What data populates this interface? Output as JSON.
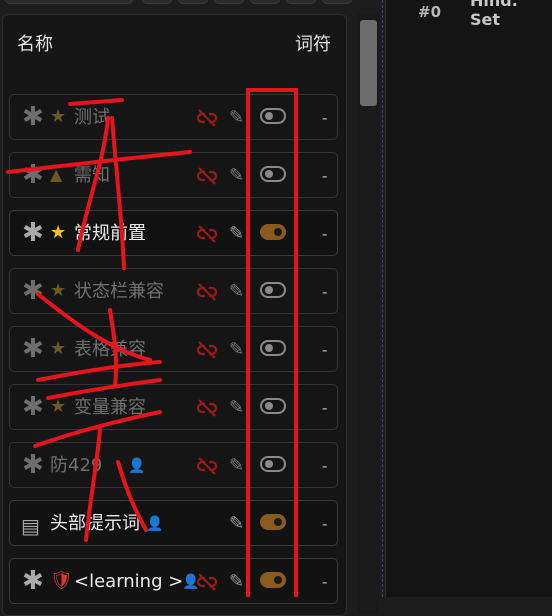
{
  "header": {
    "name_col": "名称",
    "token_col": "词符"
  },
  "editor": {
    "index_label": "#0",
    "heading_cut": "Hind. Set"
  },
  "rows": [
    {
      "lead": "✱",
      "type_icon": "★",
      "type_color": "#6b5a22",
      "name": "测试",
      "enabled": false,
      "has_person": false,
      "has_unlink": true,
      "token": "-"
    },
    {
      "lead": "✱",
      "type_icon": "▲",
      "type_color": "#6b5a22",
      "name": "需知",
      "enabled": false,
      "has_person": false,
      "has_unlink": true,
      "token": "-"
    },
    {
      "lead": "✱",
      "type_icon": "★",
      "type_color": "#f5c518",
      "name": "常规前置",
      "enabled": true,
      "has_person": false,
      "has_unlink": true,
      "token": "-"
    },
    {
      "lead": "✱",
      "type_icon": "★",
      "type_color": "#6b5a22",
      "name": "状态栏兼容",
      "enabled": false,
      "has_person": false,
      "has_unlink": true,
      "token": "-"
    },
    {
      "lead": "✱",
      "type_icon": "★",
      "type_color": "#6b5a22",
      "name": "表格兼容",
      "enabled": false,
      "has_person": false,
      "has_unlink": true,
      "token": "-"
    },
    {
      "lead": "✱",
      "type_icon": "★",
      "type_color": "#6b5a22",
      "name": "变量兼容",
      "enabled": false,
      "has_person": false,
      "has_unlink": true,
      "token": "-"
    },
    {
      "lead": "✱",
      "type_icon": "",
      "type_color": "#6b5a22",
      "name": "防429",
      "enabled": false,
      "has_person": true,
      "has_unlink": true,
      "token": "-"
    },
    {
      "lead": "▤",
      "type_icon": "",
      "type_color": "#aaaaaa",
      "name": "头部提示词",
      "enabled": true,
      "has_person": true,
      "has_unlink": false,
      "token": "-"
    },
    {
      "lead": "✱",
      "type_icon": "🛡",
      "type_color": "#d33",
      "name": "<learning >",
      "enabled": true,
      "has_person": true,
      "has_unlink": true,
      "token": "-"
    }
  ]
}
